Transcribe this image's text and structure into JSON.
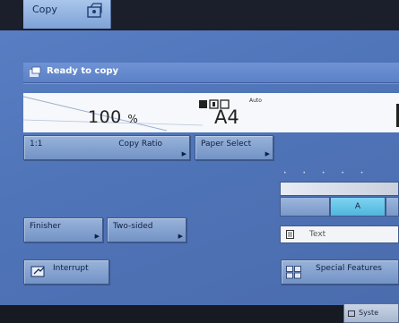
{
  "tabs": {
    "copy_label": "Copy"
  },
  "status": {
    "message": "Ready to copy"
  },
  "display": {
    "ratio_value": "100",
    "ratio_unit": "%",
    "paper_value": "A4",
    "mini_label": "Auto"
  },
  "buttons": {
    "ratio_preset": "1:1",
    "copy_ratio": "Copy Ratio",
    "paper_select": "Paper Select",
    "finisher": "Finisher",
    "two_sided": "Two-sided",
    "interrupt": "Interrupt",
    "special_features": "Special Features",
    "system": "Syste"
  },
  "density": {
    "segments": [
      "",
      "A",
      ""
    ],
    "active_index": 1
  },
  "original": {
    "label": "Text"
  },
  "colors": {
    "screen_blue": "#5a7fc4",
    "button_blue": "#7f9dcd",
    "active_cyan": "#4fb6de",
    "dark_frame": "#1b1f2c"
  },
  "icons": [
    "copy-tab-icon",
    "status-copy-icon",
    "mode-icons",
    "interrupt-icon",
    "special-features-icon",
    "document-icon"
  ]
}
